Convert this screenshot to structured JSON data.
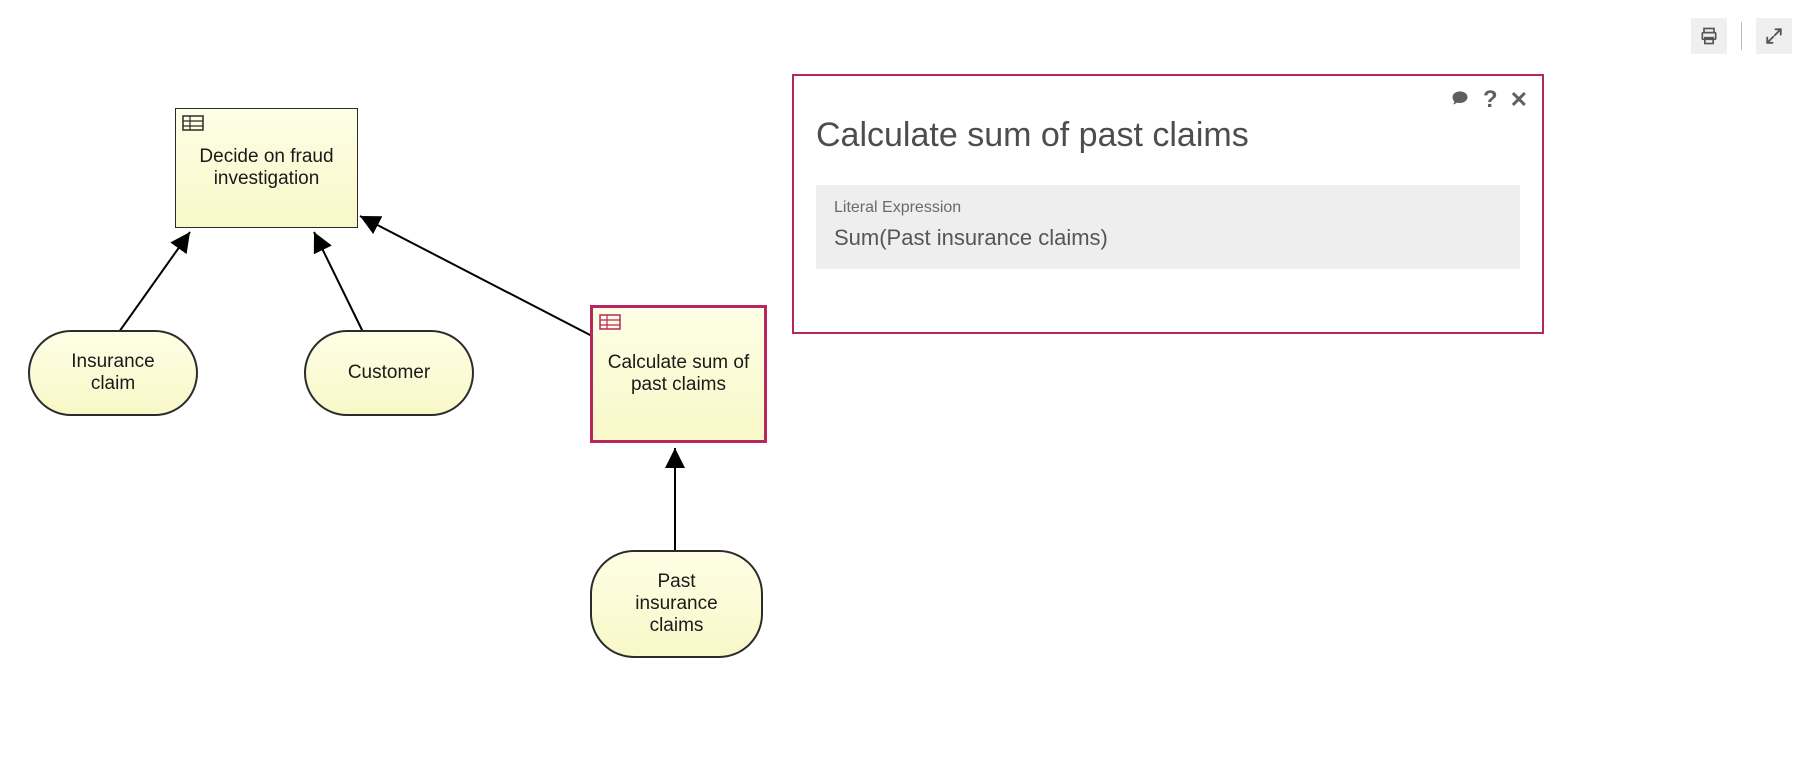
{
  "toolbar": {
    "print_icon": "print-icon",
    "expand_icon": "expand-icon"
  },
  "diagram": {
    "decision_main": {
      "label": "Decide on fraud investigation"
    },
    "decision_calc": {
      "label": "Calculate sum of past claims"
    },
    "input_claim": {
      "label": "Insurance claim"
    },
    "input_customer": {
      "label": "Customer"
    },
    "input_past": {
      "label": "Past insurance claims"
    }
  },
  "panel": {
    "title": "Calculate sum of past claims",
    "section_label": "Literal Expression",
    "expression": "Sum(Past insurance claims)",
    "actions": {
      "comment": "comment-icon",
      "help": "?",
      "close": "✕"
    }
  }
}
